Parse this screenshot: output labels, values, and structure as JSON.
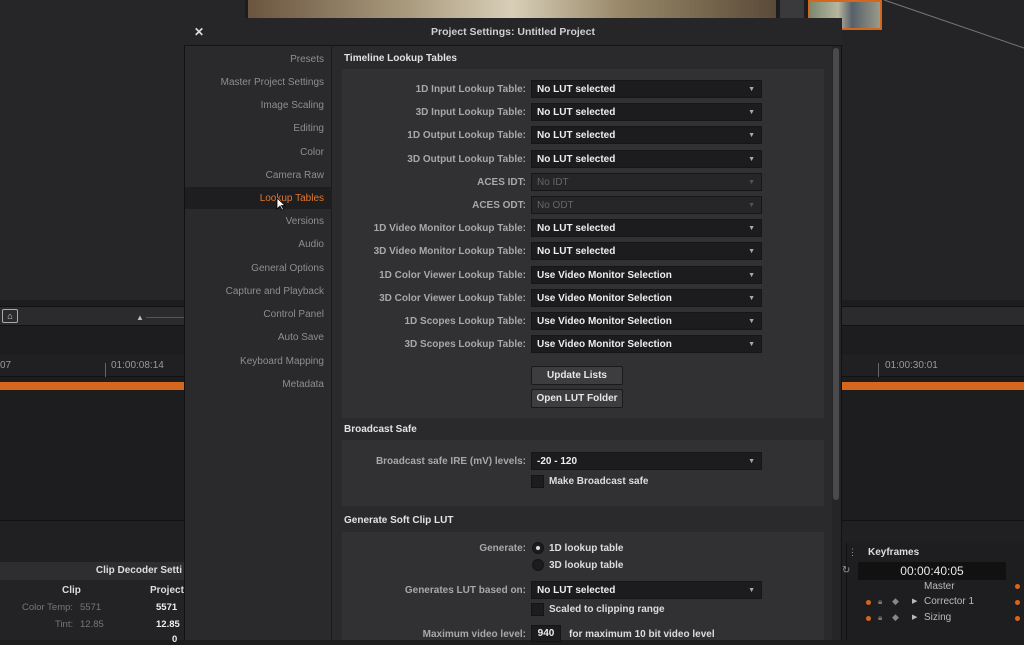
{
  "background": {
    "timecodes": [
      "07",
      "01:00:08:14",
      "01:00:30:01"
    ],
    "clip_decoder": {
      "title": "Clip Decoder Setti",
      "col_clip": "Clip",
      "col_project": "Project",
      "rows": [
        {
          "label": "Color Temp:",
          "clip": "5571",
          "project": "5571"
        },
        {
          "label": "Tint:",
          "clip": "12.85",
          "project": "12.85"
        },
        {
          "label": "",
          "clip": "",
          "project": "0"
        }
      ]
    },
    "keyframes": {
      "title": "Keyframes",
      "time": "00:00:40:05",
      "rows": [
        "Master",
        "Corrector 1",
        "Sizing"
      ]
    }
  },
  "dialog": {
    "title": "Project Settings:  Untitled Project",
    "close_icon": "close-icon"
  },
  "sidebar": {
    "items": [
      {
        "label": "Presets",
        "active": false
      },
      {
        "label": "Master Project Settings",
        "active": false
      },
      {
        "label": "Image Scaling",
        "active": false
      },
      {
        "label": "Editing",
        "active": false
      },
      {
        "label": "Color",
        "active": false
      },
      {
        "label": "Camera Raw",
        "active": false
      },
      {
        "label": "Lookup Tables",
        "active": true
      },
      {
        "label": "Versions",
        "active": false
      },
      {
        "label": "Audio",
        "active": false
      },
      {
        "label": "General Options",
        "active": false
      },
      {
        "label": "Capture and Playback",
        "active": false
      },
      {
        "label": "Control Panel",
        "active": false
      },
      {
        "label": "Auto Save",
        "active": false
      },
      {
        "label": "Keyboard Mapping",
        "active": false
      },
      {
        "label": "Metadata",
        "active": false
      }
    ]
  },
  "timeline_luts": {
    "heading": "Timeline Lookup Tables",
    "rows": [
      {
        "label": "1D Input Lookup Table:",
        "value": "No LUT selected",
        "disabled": false
      },
      {
        "label": "3D Input Lookup Table:",
        "value": "No LUT selected",
        "disabled": false
      },
      {
        "label": "1D Output Lookup Table:",
        "value": "No LUT selected",
        "disabled": false
      },
      {
        "label": "3D Output Lookup Table:",
        "value": "No LUT selected",
        "disabled": false
      },
      {
        "label": "ACES IDT:",
        "value": "No IDT",
        "disabled": true
      },
      {
        "label": "ACES ODT:",
        "value": "No ODT",
        "disabled": true
      },
      {
        "label": "1D Video Monitor Lookup Table:",
        "value": "No LUT selected",
        "disabled": false
      },
      {
        "label": "3D Video Monitor Lookup Table:",
        "value": "No LUT selected",
        "disabled": false
      },
      {
        "label": "1D Color Viewer Lookup Table:",
        "value": "Use Video Monitor Selection",
        "disabled": false
      },
      {
        "label": "3D Color Viewer Lookup Table:",
        "value": "Use Video Monitor Selection",
        "disabled": false
      },
      {
        "label": "1D Scopes Lookup Table:",
        "value": "Use Video Monitor Selection",
        "disabled": false
      },
      {
        "label": "3D Scopes Lookup Table:",
        "value": "Use Video Monitor Selection",
        "disabled": false
      }
    ],
    "update_lists": "Update Lists",
    "open_lut_folder": "Open LUT Folder"
  },
  "broadcast_safe": {
    "heading": "Broadcast Safe",
    "ire_label": "Broadcast safe IRE (mV) levels:",
    "ire_value": "-20 - 120",
    "make_safe_label": "Make Broadcast safe",
    "make_safe_checked": false
  },
  "soft_clip": {
    "heading": "Generate Soft Clip LUT",
    "generate_label": "Generate:",
    "option_1d": "1D lookup table",
    "option_3d": "3D lookup table",
    "selected": "1D lookup table",
    "based_on_label": "Generates LUT based on:",
    "based_on_value": "No LUT selected",
    "scaled_label": "Scaled to clipping range",
    "scaled_checked": false,
    "max_video_label": "Maximum video level:",
    "max_video_value": "940",
    "max_video_note": "for maximum 10 bit video level"
  },
  "colors": {
    "accent": "#d4661e",
    "active_item": "#e0782e"
  }
}
